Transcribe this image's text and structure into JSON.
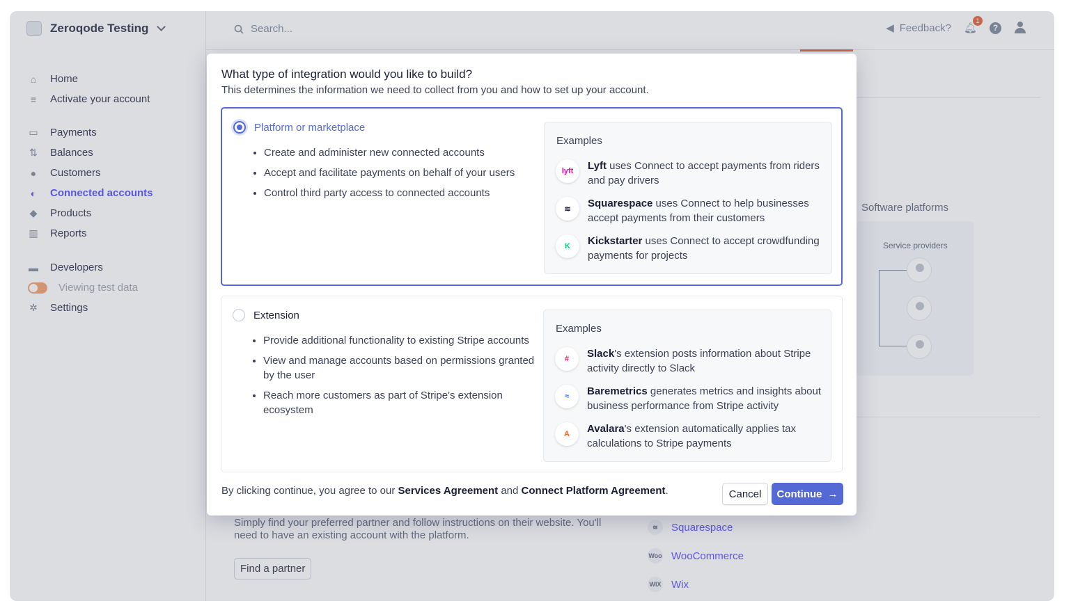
{
  "account": {
    "name": "Zeroqode Testing"
  },
  "sidebar": {
    "groups": [
      [
        {
          "label": "Home",
          "icon": "home-icon"
        },
        {
          "label": "Activate your account",
          "icon": "checklist-icon"
        }
      ],
      [
        {
          "label": "Payments",
          "icon": "card-icon"
        },
        {
          "label": "Balances",
          "icon": "arrows-icon"
        },
        {
          "label": "Customers",
          "icon": "user-icon"
        },
        {
          "label": "Connected accounts",
          "icon": "globe-icon"
        },
        {
          "label": "Products",
          "icon": "box-icon"
        },
        {
          "label": "Reports",
          "icon": "chart-icon"
        }
      ],
      [
        {
          "label": "Developers",
          "icon": "terminal-icon"
        },
        {
          "label": "Viewing test data",
          "icon": "toggle"
        },
        {
          "label": "Settings",
          "icon": "gear-icon"
        }
      ]
    ],
    "active": "Connected accounts"
  },
  "topbar": {
    "search_placeholder": "Search...",
    "feedback": "Feedback?",
    "notification_count": "1"
  },
  "background": {
    "software_platforms": "Software platforms",
    "service_providers": "Service providers",
    "partner_text": "Simply find your preferred partner and follow instructions on their website. You'll need to have an existing account with the platform.",
    "find_partner": "Find a partner",
    "partners": [
      {
        "name": "Squarespace",
        "mark": "≋"
      },
      {
        "name": "WooCommerce",
        "mark": "Woo"
      },
      {
        "name": "Wix",
        "mark": "WIX"
      }
    ]
  },
  "modal": {
    "title": "What type of integration would you like to build?",
    "subtitle": "This determines the information we need to collect from you and how to set up your account.",
    "examples_label": "Examples",
    "options": [
      {
        "title": "Platform or marketplace",
        "selected": true,
        "bullets": [
          "Create and administer new connected accounts",
          "Accept and facilitate payments on behalf of your users",
          "Control third party access to connected accounts"
        ],
        "examples": [
          {
            "name": "Lyft",
            "text": " uses Connect to accept payments from riders and pay drivers",
            "mark": "lyft",
            "color": "#ff00bf"
          },
          {
            "name": "Squarespace",
            "text": " uses Connect to help businesses accept payments from their customers",
            "mark": "≋",
            "color": "#1a1f36"
          },
          {
            "name": "Kickstarter",
            "text": " uses Connect to accept crowdfunding payments for projects",
            "mark": "K",
            "color": "#05ce78"
          }
        ]
      },
      {
        "title": "Extension",
        "selected": false,
        "bullets": [
          "Provide additional functionality to existing Stripe accounts",
          "View and manage accounts based on permissions granted by the user",
          "Reach more customers as part of Stripe's extension ecosystem"
        ],
        "examples": [
          {
            "name": "Slack",
            "text": "'s extension posts information about Stripe activity directly to Slack",
            "mark": "#",
            "color": "#e01e5a"
          },
          {
            "name": "Baremetrics",
            "text": " generates metrics and insights about business performance from Stripe activity",
            "mark": "≈",
            "color": "#4b6cf5"
          },
          {
            "name": "Avalara",
            "text": "'s extension automatically applies tax calculations to Stripe payments",
            "mark": "A",
            "color": "#f26522"
          }
        ]
      }
    ],
    "footer": {
      "prefix": "By clicking continue, you agree to our ",
      "link1": "Services Agreement",
      "middle": " and ",
      "link2": "Connect Platform Agreement",
      "suffix": "."
    },
    "cancel": "Cancel",
    "continue": "Continue"
  }
}
